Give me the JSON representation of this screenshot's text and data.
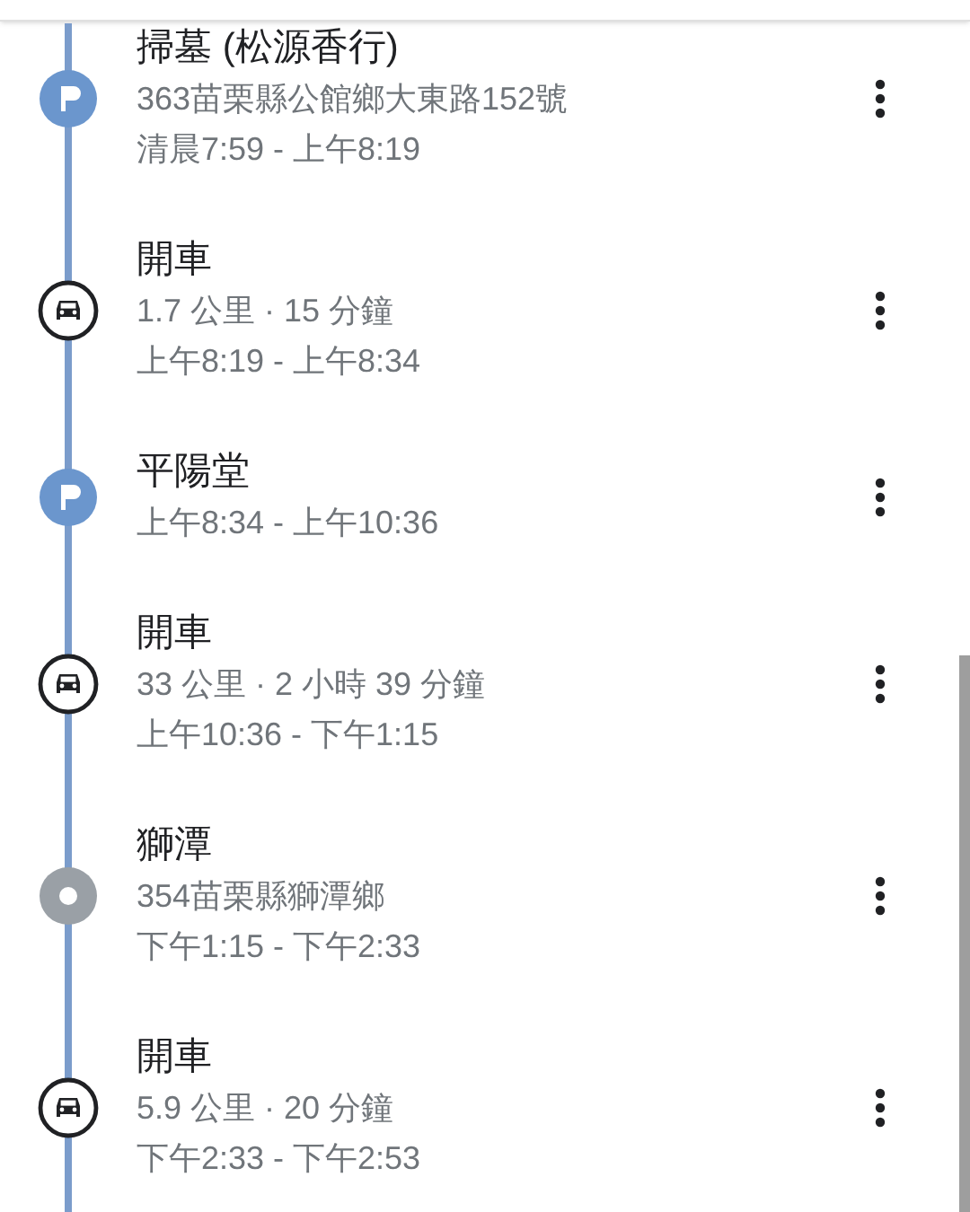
{
  "timeline": [
    {
      "kind": "place",
      "title": "掃墓 (松源香行)",
      "lines": [
        "363苗栗縣公館鄉大東路152號",
        "清晨7:59 - 上午8:19"
      ]
    },
    {
      "kind": "drive",
      "title": "開車",
      "lines": [
        "1.7 公里 · 15 分鐘",
        "上午8:19 - 上午8:34"
      ]
    },
    {
      "kind": "place",
      "title": "平陽堂",
      "lines": [
        "上午8:34 - 上午10:36"
      ]
    },
    {
      "kind": "drive",
      "title": "開車",
      "lines": [
        "33 公里 · 2 小時 39 分鐘",
        "上午10:36 - 下午1:15"
      ]
    },
    {
      "kind": "waypoint",
      "title": "獅潭",
      "lines": [
        "354苗栗縣獅潭鄉",
        "下午1:15 - 下午2:33"
      ]
    },
    {
      "kind": "drive",
      "title": "開車",
      "lines": [
        "5.9 公里 · 20 分鐘",
        "下午2:33 - 下午2:53"
      ]
    }
  ]
}
